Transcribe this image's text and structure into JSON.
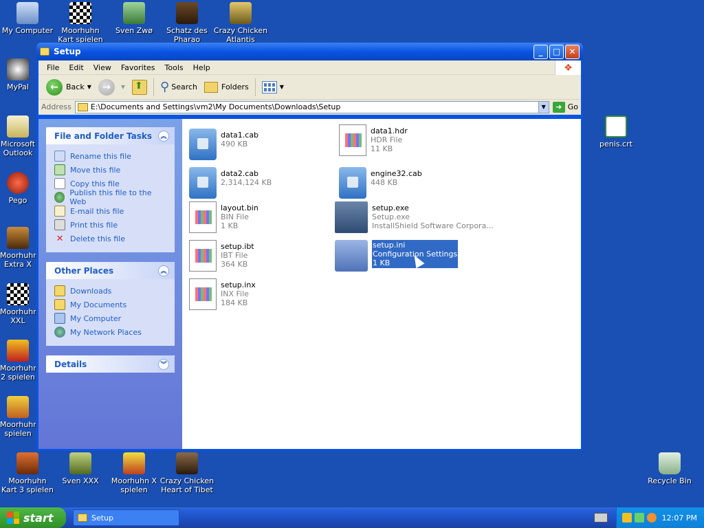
{
  "desktop": {
    "icons": [
      {
        "label": "My Computer"
      },
      {
        "label": "Moorhuhn Kart spielen"
      },
      {
        "label": "Sven Zwø"
      },
      {
        "label": "Schatz des Pharao spielen"
      },
      {
        "label": "Crazy Chicken Atlantis"
      },
      {
        "label": "MyPal"
      },
      {
        "label": "Microsoft Outlook"
      },
      {
        "label": "Pego"
      },
      {
        "label": "Moorhuhn Extra X"
      },
      {
        "label": "Moorhuhn XXL"
      },
      {
        "label": "Moorhuhn 2 spielen"
      },
      {
        "label": "Moorhuhn spielen"
      },
      {
        "label": "Moorhuhn Kart 3 spielen"
      },
      {
        "label": "Sven XXX"
      },
      {
        "label": "Moorhuhn X spielen"
      },
      {
        "label": "Crazy Chicken Heart of Tibet"
      },
      {
        "label": "penis.crt"
      },
      {
        "label": "Recycle Bin"
      }
    ]
  },
  "window": {
    "title": "Setup",
    "menu": [
      "File",
      "Edit",
      "View",
      "Favorites",
      "Tools",
      "Help"
    ],
    "toolbar": {
      "back": "Back",
      "search": "Search",
      "folders": "Folders"
    },
    "address": {
      "label": "Address",
      "value": "E:\\Documents and Settings\\vm2\\My Documents\\Downloads\\Setup",
      "go": "Go"
    },
    "tasks": {
      "file_folder": {
        "title": "File and Folder Tasks",
        "links": [
          "Rename this file",
          "Move this file",
          "Copy this file",
          "Publish this file to the Web",
          "E-mail this file",
          "Print this file",
          "Delete this file"
        ]
      },
      "other_places": {
        "title": "Other Places",
        "links": [
          "Downloads",
          "My Documents",
          "My Computer",
          "My Network Places"
        ]
      },
      "details": {
        "title": "Details"
      }
    },
    "files": [
      {
        "name": "data1.cab",
        "type": "",
        "size": "490 KB"
      },
      {
        "name": "data1.hdr",
        "type": "HDR File",
        "size": "11 KB"
      },
      {
        "name": "data2.cab",
        "type": "",
        "size": "2,314,124 KB"
      },
      {
        "name": "engine32.cab",
        "type": "",
        "size": "448 KB"
      },
      {
        "name": "layout.bin",
        "type": "BIN File",
        "size": "1 KB"
      },
      {
        "name": "setup.exe",
        "type": "Setup.exe",
        "size": "InstallShield Software Corpora..."
      },
      {
        "name": "setup.ibt",
        "type": "IBT File",
        "size": "364 KB"
      },
      {
        "name": "setup.ini",
        "type": "Configuration Settings",
        "size": "1 KB"
      },
      {
        "name": "setup.inx",
        "type": "INX File",
        "size": "184 KB"
      }
    ]
  },
  "taskbar": {
    "start": "start",
    "task": "Setup",
    "clock": "12:07 PM"
  }
}
